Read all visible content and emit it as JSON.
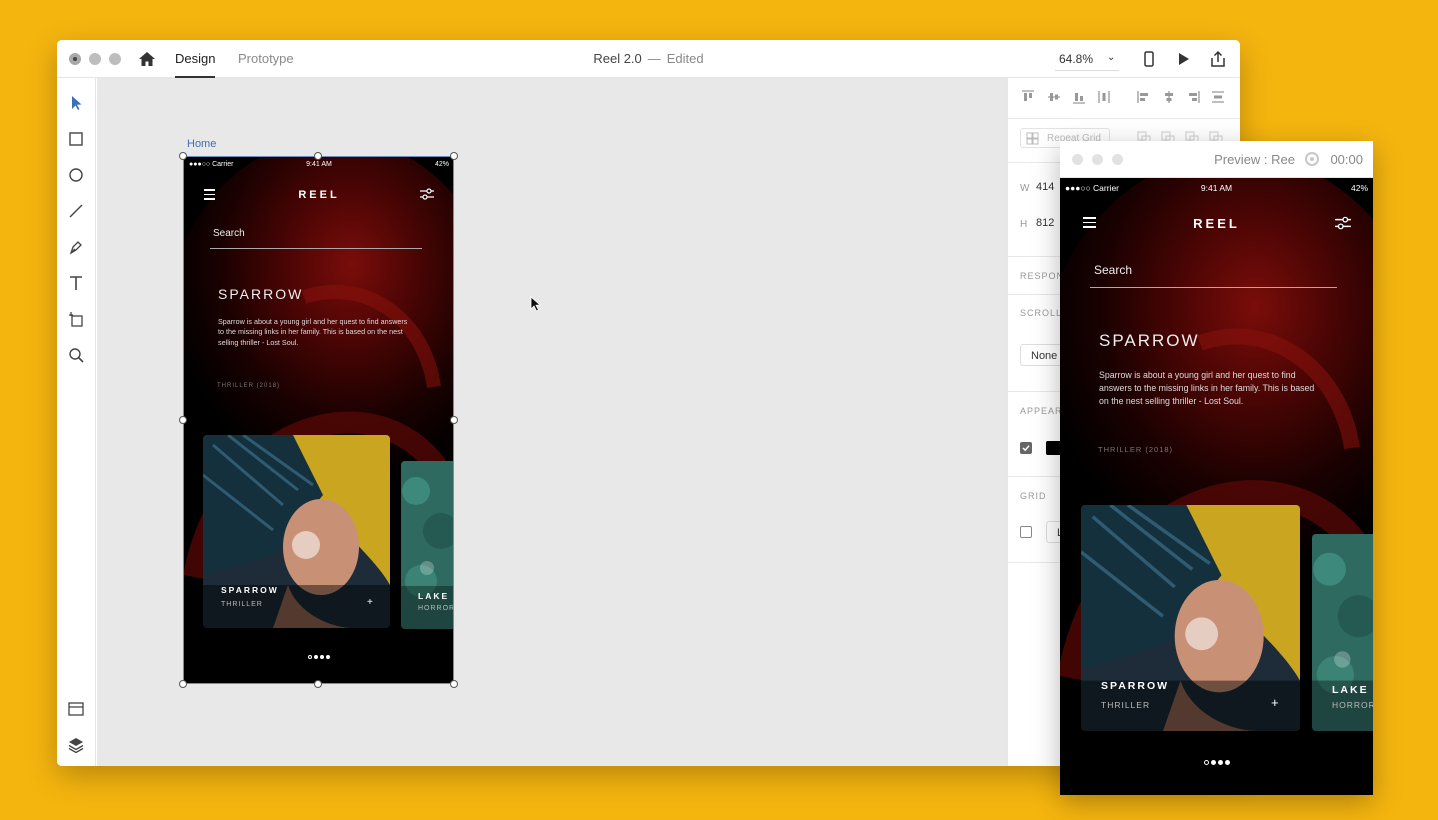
{
  "window": {
    "tabs": {
      "design": "Design",
      "prototype": "Prototype"
    },
    "title": "Reel 2.0",
    "title_sep": "—",
    "status": "Edited",
    "zoom": "64.8%"
  },
  "canvas": {
    "artboard_label": "Home"
  },
  "app": {
    "status": {
      "carrier": "●●●○○ Carrier",
      "time": "9:41 AM",
      "battery": "42%"
    },
    "brand": "REEL",
    "search_placeholder": "Search",
    "movie": {
      "title": "SPARROW",
      "description": "Sparrow is about a young girl and her quest to find answers to the missing links in her family. This is based on the nest selling thriller - Lost Soul.",
      "genre": "THRILLER (2018)"
    },
    "cards": [
      {
        "title": "SPARROW",
        "sub": "THRILLER"
      },
      {
        "title": "LAKE",
        "sub": "HORROR"
      }
    ],
    "plus": "+"
  },
  "properties": {
    "repeat_grid": "Repeat Grid",
    "w_label": "W",
    "w_value": "414",
    "h_label": "H",
    "h_value": "812",
    "responsive": "RESPONSIVE",
    "scrolling": "SCROLLING",
    "scroll_value": "None",
    "appearance": "APPEARANCE",
    "grid": "GRID",
    "grid_value": "L"
  },
  "preview": {
    "title": "Preview : Ree",
    "time": "00:00"
  },
  "colors": {
    "accent": "#3b6fb6",
    "background": "#F5B50F"
  }
}
